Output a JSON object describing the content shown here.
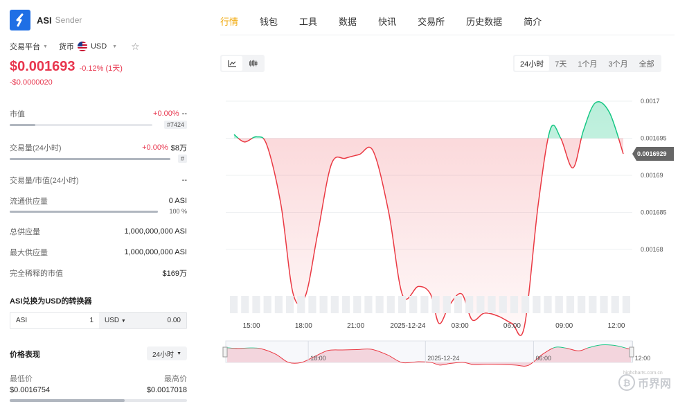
{
  "coin": {
    "symbol": "ASI",
    "name": "Sender"
  },
  "selectors": {
    "exchange": "交易平台",
    "currency_label": "货币",
    "currency": "USD"
  },
  "price": {
    "value": "$0.001693",
    "change_pct": "-0.12% (1天)",
    "change_abs": "-$0.0000020"
  },
  "stats": {
    "market_cap": {
      "label": "市值",
      "change": "+0.00%",
      "value": "--",
      "rank": "#7424",
      "fill": 0.18
    },
    "volume": {
      "label": "交易量(24小时)",
      "change": "+0.00%",
      "value": "$8万",
      "rank": "#",
      "fill": 1.0
    },
    "vol_mcap": {
      "label": "交易量/市值(24小时)",
      "value": "--"
    },
    "circ_supply": {
      "label": "流通供应量",
      "value": "0 ASI",
      "pct": "100 %",
      "fill": 1.0
    },
    "total_supply": {
      "label": "总供应量",
      "value": "1,000,000,000 ASI"
    },
    "max_supply": {
      "label": "最大供应量",
      "value": "1,000,000,000 ASI"
    },
    "fdv": {
      "label": "完全稀释的市值",
      "value": "$169万"
    }
  },
  "converter": {
    "title": "ASI兑换为USD的转换器",
    "from_sym": "ASI",
    "from_val": "1",
    "to_sym": "USD",
    "to_val": "0.00"
  },
  "performance": {
    "title": "价格表现",
    "range": "24小时",
    "low_label": "最低价",
    "high_label": "最高价",
    "low": "$0.0016754",
    "high": "$0.0017018",
    "fill": 0.65
  },
  "tabs": [
    "行情",
    "钱包",
    "工具",
    "数据",
    "快讯",
    "交易所",
    "历史数据",
    "简介"
  ],
  "ranges": [
    "24小时",
    "7天",
    "1个月",
    "3个月",
    "全部"
  ],
  "colors": {
    "up": "#16c784",
    "down": "#ea3943",
    "accent": "#f0a500",
    "price_red": "#e8364e"
  },
  "watermark": {
    "text": "币界网",
    "url": "highcharts.com.cn"
  },
  "chart_data": {
    "type": "area",
    "y_ticks": [
      "0.0017",
      "0.001695",
      "0.00169",
      "0.001685",
      "0.00168"
    ],
    "ylim": [
      0.001677,
      0.0017015
    ],
    "baseline": 0.001695,
    "current_label": "0.0016929",
    "current": 0.0016929,
    "x_ticks": [
      {
        "t": 1.0,
        "label": "15:00"
      },
      {
        "t": 4.0,
        "label": "18:00"
      },
      {
        "t": 7.0,
        "label": "21:00"
      },
      {
        "t": 10.0,
        "label": "2025-12-24"
      },
      {
        "t": 13.0,
        "label": "03:00"
      },
      {
        "t": 16.0,
        "label": "06:00"
      },
      {
        "t": 19.0,
        "label": "09:00"
      },
      {
        "t": 22.0,
        "label": "12:00"
      }
    ],
    "nav_ticks": [
      {
        "t": 4.5,
        "label": "18:00"
      },
      {
        "t": 11.0,
        "label": "2025-12-24"
      },
      {
        "t": 17.0,
        "label": "06:00"
      },
      {
        "t": 22.5,
        "label": "12:00"
      }
    ],
    "points": [
      [
        0.0,
        0.0016955
      ],
      [
        0.6,
        0.0016945
      ],
      [
        1.3,
        0.0016952
      ],
      [
        1.9,
        0.001694
      ],
      [
        2.7,
        0.001686
      ],
      [
        3.4,
        0.001674
      ],
      [
        4.1,
        0.0016737
      ],
      [
        4.8,
        0.001682
      ],
      [
        5.6,
        0.0016915
      ],
      [
        6.4,
        0.0016923
      ],
      [
        7.2,
        0.0016928
      ],
      [
        8.0,
        0.0016933
      ],
      [
        8.9,
        0.001685
      ],
      [
        9.7,
        0.0016738
      ],
      [
        10.6,
        0.001675
      ],
      [
        11.3,
        0.001674
      ],
      [
        11.8,
        0.00167
      ],
      [
        12.4,
        0.0016725
      ],
      [
        13.1,
        0.001674
      ],
      [
        13.7,
        0.0016705
      ],
      [
        14.4,
        0.0016714
      ],
      [
        15.2,
        0.001671
      ],
      [
        16.0,
        0.00167
      ],
      [
        16.7,
        0.0016695
      ],
      [
        17.5,
        0.001686
      ],
      [
        18.2,
        0.0016962
      ],
      [
        18.8,
        0.001695
      ],
      [
        19.5,
        0.001691
      ],
      [
        20.1,
        0.001696
      ],
      [
        20.8,
        0.0016998
      ],
      [
        21.6,
        0.0016985
      ],
      [
        22.4,
        0.0016929
      ]
    ],
    "volume_bars": 36
  }
}
